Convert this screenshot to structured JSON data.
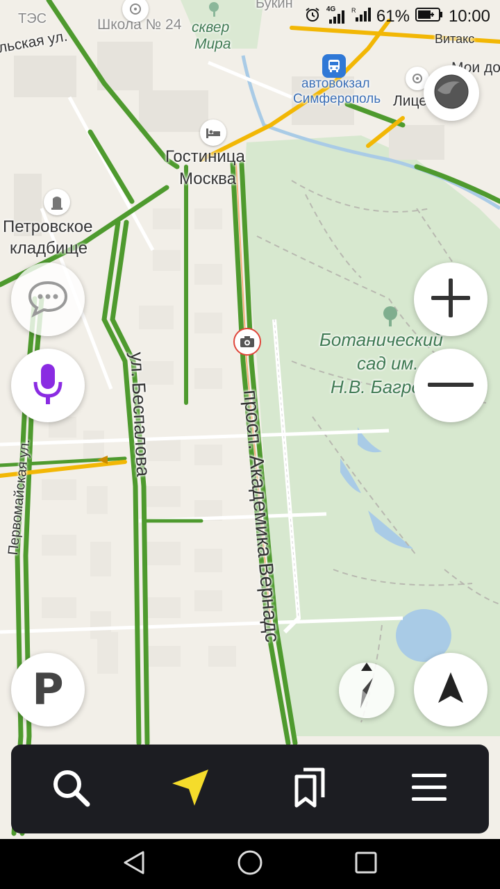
{
  "status_bar": {
    "network": "4G",
    "battery": "61%",
    "time": "10:00"
  },
  "map_labels": {
    "tes": "ТЭС",
    "school": "Школа № 24",
    "bookin": "Букин",
    "square_line1": "сквер",
    "square_line2": "Мира",
    "street_top_left": "льская ул.",
    "bus_station_line1": "автовокзал",
    "bus_station_line2": "Симферополь",
    "liceum": "Лицей",
    "vitaks": "Витакс",
    "moi_do": "Мои до",
    "hotel_line1": "Гостиница",
    "hotel_line2": "Москва",
    "cemetery_line1": "Петровское",
    "cemetery_line2": "кладбище",
    "garden_line1": "Ботанический",
    "garden_line2": "сад им.",
    "garden_line3": "Н.В. Багрова",
    "street_bespalova": "ул. Беспалова",
    "street_vernadsky": "просп. Академика Вернадс",
    "street_pervomaiskaya": "Первомайская ул."
  },
  "controls": {
    "parking_label": "P"
  },
  "icons": {
    "layers": "layers-icon",
    "chat": "chat-bubble-icon",
    "voice": "microphone-icon",
    "zoom_in": "plus-icon",
    "zoom_out": "minus-icon",
    "compass": "compass-icon",
    "locate": "navigation-arrow-icon",
    "search": "search-icon",
    "route": "route-arrow-icon",
    "bookmarks": "bookmarks-icon",
    "menu": "menu-icon"
  },
  "colors": {
    "traffic_green": "#4e9a2e",
    "traffic_yellow": "#f2b705",
    "park_green": "#cfe4c8",
    "water": "#a9cbe6",
    "voice_purple": "#8a2be2",
    "tabbar_bg": "#1c1d22",
    "route_yellow": "#f5dc2b"
  }
}
